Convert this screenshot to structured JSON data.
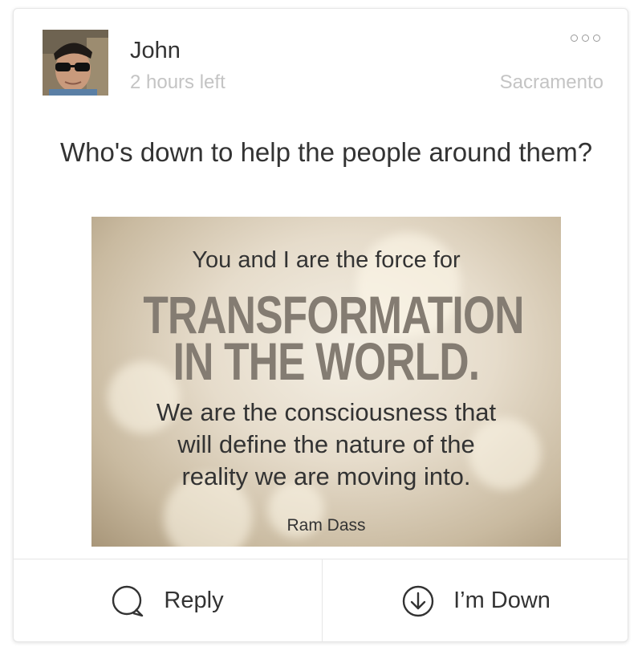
{
  "post": {
    "author": "John",
    "time_left": "2 hours left",
    "location": "Sacramento",
    "text": "Who's down to help the people around them?"
  },
  "icons": {
    "more": "more-options-icon",
    "reply": "speech-bubble-icon",
    "down": "arrow-down-circle-icon"
  },
  "quote_image": {
    "line1": "You and I are the force for",
    "big1": "TRANSFORMATION",
    "big2": "IN THE WORLD.",
    "small1": "We are the consciousness that",
    "small2": "will define the nature of the",
    "small3": "reality we are moving into.",
    "author": "Ram Dass"
  },
  "actions": {
    "reply_label": "Reply",
    "down_label": "I’m Down"
  },
  "colors": {
    "text": "#333333",
    "muted": "#c4c4c4",
    "border": "#e6e6e6"
  }
}
